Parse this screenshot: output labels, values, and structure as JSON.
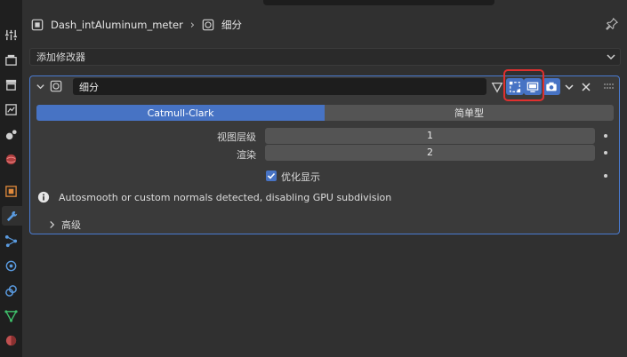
{
  "header": {
    "object_name": "Dash_intAluminum_meter",
    "modifier_name": "细分"
  },
  "add_modifier": {
    "label": "添加修改器"
  },
  "modifier": {
    "name_value": "细分",
    "toggle_left": "Catmull-Clark",
    "toggle_right": "简单型",
    "viewport_levels": {
      "label": "视图层级",
      "value": "1"
    },
    "render_levels": {
      "label": "渲染",
      "value": "2"
    },
    "optimal_display": {
      "label": "优化显示",
      "checked": true
    },
    "info_message": "Autosmooth or custom normals detected, disabling GPU subdivision",
    "advanced_label": "高级"
  },
  "colors": {
    "accent": "#4773c4",
    "highlight": "#e0302f",
    "panel_border": "#4a7bd1"
  },
  "icons": [
    "tool-icon",
    "render-icon",
    "output-icon",
    "view-layer-icon",
    "scene-icon",
    "world-icon",
    "object-icon",
    "modifier-wrench-icon",
    "particles-icon",
    "physics-icon",
    "constraints-icon",
    "data-icon",
    "material-icon"
  ]
}
